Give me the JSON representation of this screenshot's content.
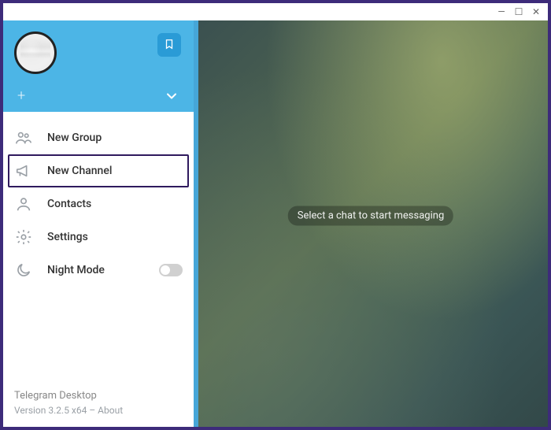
{
  "window": {
    "minimize": "—",
    "maximize": "☐",
    "close": "✕"
  },
  "header": {
    "plus": "+",
    "bookmark_icon": "bookmark-icon",
    "chevron_icon": "chevron-down-icon",
    "avatar_icon": "avatar"
  },
  "menu": {
    "items": [
      {
        "key": "new-group",
        "label": "New Group",
        "icon": "group-icon"
      },
      {
        "key": "new-channel",
        "label": "New Channel",
        "icon": "megaphone-icon",
        "highlighted": true
      },
      {
        "key": "contacts",
        "label": "Contacts",
        "icon": "person-icon"
      },
      {
        "key": "settings",
        "label": "Settings",
        "icon": "gear-icon"
      },
      {
        "key": "night-mode",
        "label": "Night Mode",
        "icon": "moon-icon",
        "toggle": false
      }
    ]
  },
  "footer": {
    "app_name": "Telegram Desktop",
    "version_line": "Version 3.2.5 x64 – About"
  },
  "chat": {
    "placeholder": "Select a chat to start messaging"
  },
  "colors": {
    "header_bg": "#4cb5e6",
    "highlight_border": "#2f1a5e",
    "icon": "#9aa0a6"
  }
}
